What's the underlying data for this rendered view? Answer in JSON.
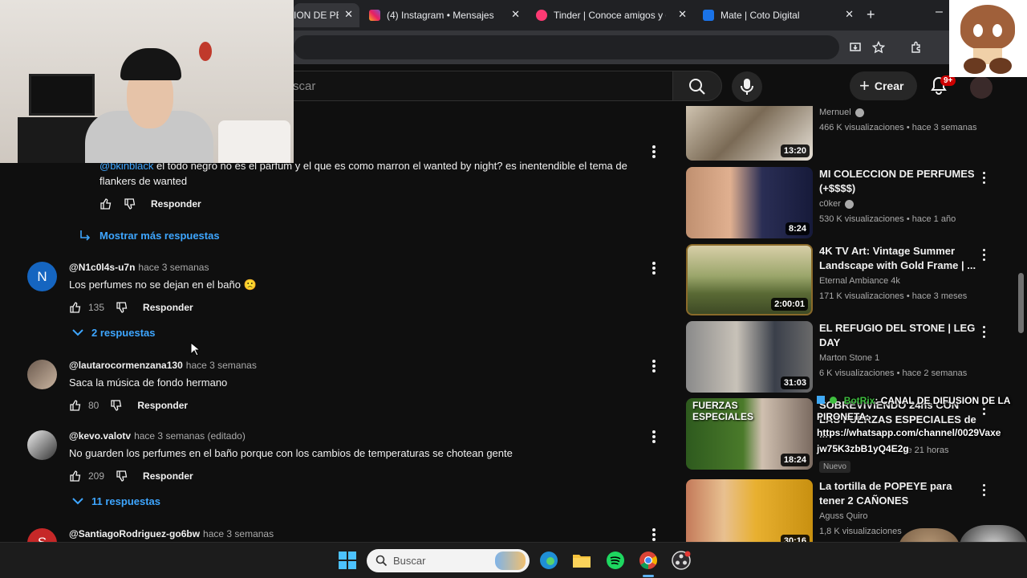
{
  "browser": {
    "tabs": [
      {
        "label": "ION DE PE",
        "active": true
      },
      {
        "label": "(4) Instagram • Mensajes",
        "active": false
      },
      {
        "label": "Tinder | Conoce amigos y ge",
        "active": false
      },
      {
        "label": "Mate | Coto Digital",
        "active": false
      }
    ],
    "new_tab": "+",
    "minimize": "–",
    "tab_close": "✕"
  },
  "header": {
    "search_placeholder": "scar",
    "create_label": "Crear",
    "notifications_count": "9+"
  },
  "comments": {
    "partial_reply": {
      "mention": "@bkinblack",
      "text_line1": "el todo negro no es el parfum y el que es como marron el wanted by night? es inentendible el tema de",
      "text_line2": "flankers de wanted",
      "reply_label": "Responder"
    },
    "show_more": "Mostrar más respuestas",
    "items": [
      {
        "avatar_letter": "N",
        "author": "@N1c0l4s-u7n",
        "ago": "hace 3 semanas",
        "text": "Los perfumes no se dejan en el baño 🙁",
        "likes": "135",
        "reply_label": "Responder",
        "replies": "2 respuestas"
      },
      {
        "author": "@lautarocormenzana130",
        "ago": "hace 3 semanas",
        "text": "Saca la música de fondo hermano",
        "likes": "80",
        "reply_label": "Responder"
      },
      {
        "author": "@kevo.valotv",
        "ago": "hace 3 semanas (editado)",
        "text": "No guarden los perfumes en el baño porque con los cambios de temperaturas se chotean gente",
        "likes": "209",
        "reply_label": "Responder",
        "replies": "11 respuestas"
      },
      {
        "avatar_letter": "S",
        "author": "@SantiagoRodriguez-go6bw",
        "ago": "hace 3 semanas"
      }
    ]
  },
  "sidebar": {
    "videos": [
      {
        "title": "",
        "channel": "Mernuel",
        "verified": true,
        "meta": "466 K visualizaciones • hace 3 semanas",
        "duration": "13:20"
      },
      {
        "title": "MI COLECCION DE PERFUMES (+$$$$)",
        "channel": "c0ker",
        "verified": true,
        "meta": "530 K visualizaciones • hace 1 año",
        "duration": "8:24"
      },
      {
        "title": "4K TV Art: Vintage Summer Landscape with Gold Frame | ...",
        "channel": "Eternal Ambiance 4k",
        "verified": false,
        "meta": "171 K visualizaciones • hace 3 meses",
        "duration": "2:00:01"
      },
      {
        "title": "EL REFUGIO DEL STONE | LEG DAY",
        "channel": "Marton Stone 1",
        "verified": false,
        "meta": "6 K visualizaciones • hace 2 semanas",
        "duration": "31:03"
      },
      {
        "title": "SOBREVIVIENDO 24hs CON LAS FUERZAS ESPECIALES de ...",
        "channel": "",
        "verified": false,
        "meta": "ce 21 horas",
        "duration": "18:24",
        "badge": "Nuevo",
        "thumb_text": "FUERZAS ESPECIALES"
      },
      {
        "title": "La tortilla de POPEYE para tener 2 CAÑONES",
        "channel": "Aguss Quiro",
        "verified": false,
        "meta": "1,8 K visualizaciones",
        "duration": "30:16"
      }
    ]
  },
  "overlay": {
    "bot_name": "BotRix",
    "message": ": CANAL DE DIFUSION DE LA PIRONETA:",
    "link_line1": "https://whatsapp.com/channel/0029Vaxe",
    "link_line2": "jw75K3zbB1yQ4E2g"
  },
  "taskbar": {
    "search_label": "Buscar"
  },
  "colors": {
    "background": "#0f0f0f",
    "link_blue": "#3ea6ff",
    "bot_green": "#3fbf3f",
    "notification_red": "#cc0000"
  }
}
